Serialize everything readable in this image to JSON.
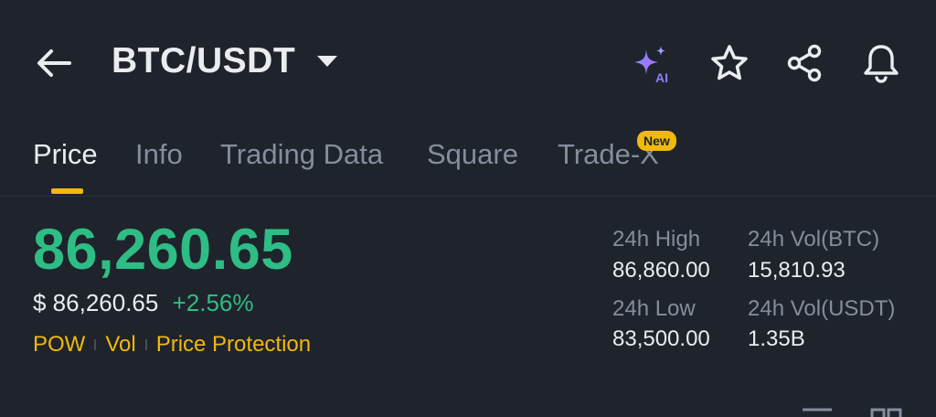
{
  "header": {
    "pair": "BTC/USDT",
    "icons": [
      "arrow-left-icon",
      "ai-sparkle-icon",
      "star-icon",
      "share-icon",
      "bell-icon"
    ],
    "ai_badge": "AI"
  },
  "tabs": [
    {
      "label": "Price",
      "active": true
    },
    {
      "label": "Info"
    },
    {
      "label": "Trading Data"
    },
    {
      "label": "Square"
    },
    {
      "label": "Trade-X",
      "badge": "New"
    }
  ],
  "price": {
    "last": "86,260.65",
    "usd": "$ 86,260.65",
    "change": "+2.56%",
    "tags": [
      "POW",
      "Vol",
      "Price Protection"
    ]
  },
  "stats": {
    "high_label": "24h High",
    "high_value": "86,860.00",
    "low_label": "24h Low",
    "low_value": "83,500.00",
    "vol_btc_label": "24h Vol(BTC)",
    "vol_btc_value": "15,810.93",
    "vol_usdt_label": "24h Vol(USDT)",
    "vol_usdt_value": "1.35B"
  },
  "colors": {
    "background": "#1f232b",
    "up": "#2ebd85",
    "accent": "#f0b90b",
    "muted": "#848e9c",
    "text": "#eaecef"
  }
}
